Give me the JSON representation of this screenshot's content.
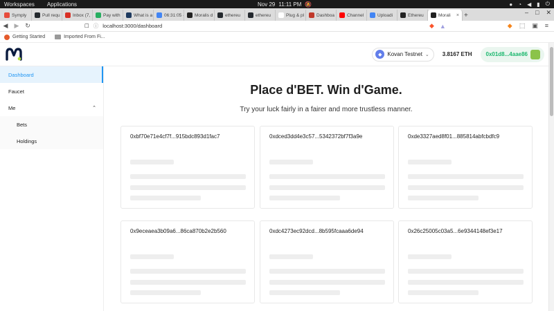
{
  "os": {
    "workspaces": "Workspaces",
    "applications": "Applications",
    "date": "Nov 29",
    "time": "11:11 PM"
  },
  "tabs": [
    {
      "label": "Symply",
      "color": "#e74c3c"
    },
    {
      "label": "Pull requ",
      "color": "#24292e"
    },
    {
      "label": "Inbox (7,",
      "color": "#d93025"
    },
    {
      "label": "Pay with",
      "color": "#27ae60"
    },
    {
      "label": "What is a",
      "color": "#1e3a5f"
    },
    {
      "label": "06:31:05 -",
      "color": "#4285f4"
    },
    {
      "label": "Moralis d",
      "color": "#222222"
    },
    {
      "label": "ethereu",
      "color": "#24292e"
    },
    {
      "label": "ethereu",
      "color": "#24292e"
    },
    {
      "label": "Plug & pl",
      "color": "#ffffff"
    },
    {
      "label": "Dashboa",
      "color": "#c0392b"
    },
    {
      "label": "Channel",
      "color": "#ff0000"
    },
    {
      "label": "Uploadi",
      "color": "#4285f4"
    },
    {
      "label": "Ethereu",
      "color": "#222222"
    },
    {
      "label": "Morali",
      "color": "#222222"
    }
  ],
  "browser": {
    "url": "localhost:3000/dashboard"
  },
  "bookmarks": {
    "item1": "Getting Started",
    "item2": "Imported From Fi..."
  },
  "header": {
    "network": "Kovan Testnet",
    "balance": "3.8167 ETH",
    "account": "0x01d8...4aae86"
  },
  "sidebar": {
    "dashboard": "Dashboard",
    "faucet": "Faucet",
    "me": "Me",
    "bets": "Bets",
    "holdings": "Holdings"
  },
  "main": {
    "title": "Place d'BET. Win d'Game.",
    "subtitle": "Try your luck fairly in a fairer and more trustless manner.",
    "cards": [
      "0xbf70e71e4cf7f...915bdc893d1fac7",
      "0xdced3dd4e3c57...5342372bf7f3a9e",
      "0xde3327aed8f01...885814abfcbdfc9",
      "0x9eceaea3b09a6...86ca870b2e2b560",
      "0xdc4273ec92dcd...8b595fcaaa6de94",
      "0x26c25005c03a5...6e9344148ef3e17"
    ]
  }
}
